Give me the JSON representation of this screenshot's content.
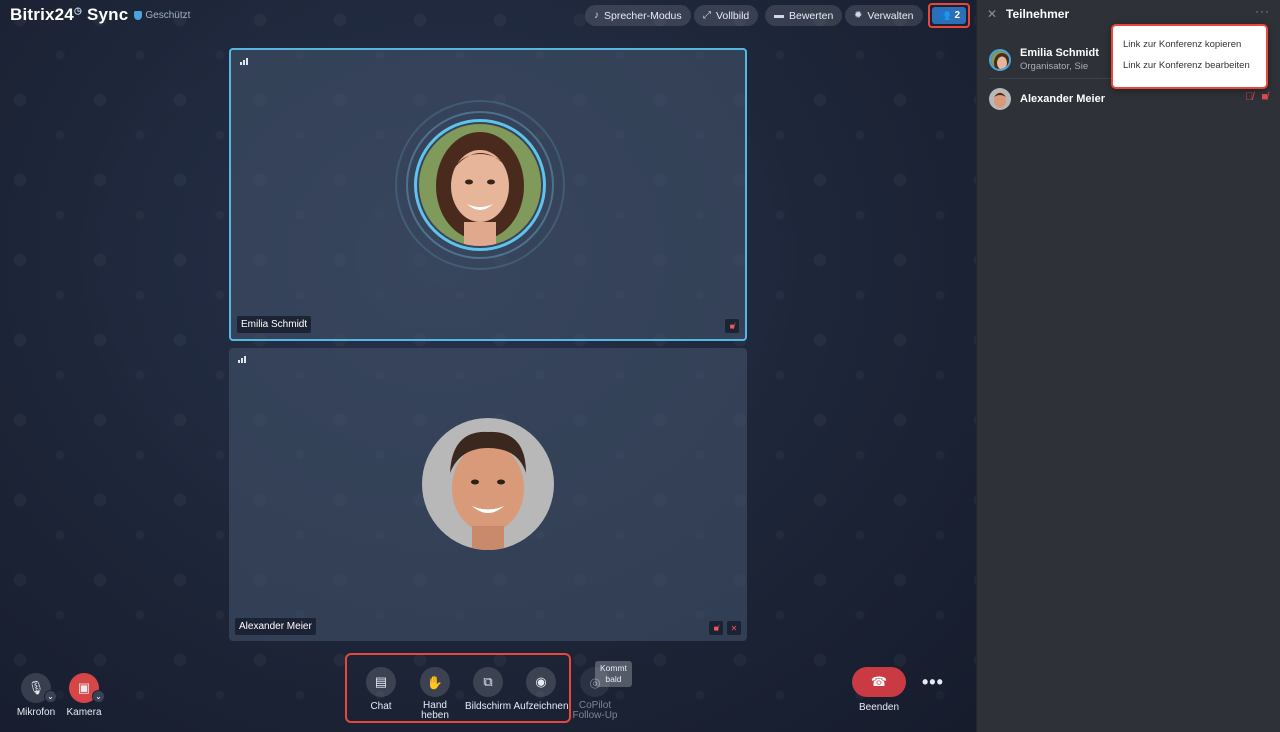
{
  "app": {
    "title": "Bitrix24",
    "title_suffix": "Sync",
    "badge": "Geschützt"
  },
  "top_buttons": {
    "speaker_mode": "Sprecher-Modus",
    "fullscreen": "Vollbild",
    "rate": "Bewerten",
    "manage": "Verwalten",
    "participants_count": "2"
  },
  "tiles": [
    {
      "name": "Emilia Schmidt"
    },
    {
      "name": "Alexander Meier"
    }
  ],
  "controls": {
    "microphone": "Mikrofon",
    "camera": "Kamera",
    "chat": "Chat",
    "raise_hand_line1": "Hand",
    "raise_hand_line2": "heben",
    "screen": "Bildschirm",
    "record": "Aufzeichnen",
    "copilot_line1": "CoPilot",
    "copilot_line2": "Follow-Up",
    "soon_line1": "Kommt",
    "soon_line2": "bald",
    "end": "Beenden"
  },
  "sidebar": {
    "title": "Teilnehmer",
    "participants": [
      {
        "name": "Emilia Schmidt",
        "role": "Organisator, Sie"
      },
      {
        "name": "Alexander Meier"
      }
    ],
    "menu": [
      "Link zur Konferenz kopieren",
      "Link zur Konferenz bearbeiten"
    ]
  },
  "colors": {
    "accent": "#55b8e3",
    "highlight": "#e8473c",
    "end_call": "#c93a42",
    "sidebar_bg": "#2e3137"
  }
}
